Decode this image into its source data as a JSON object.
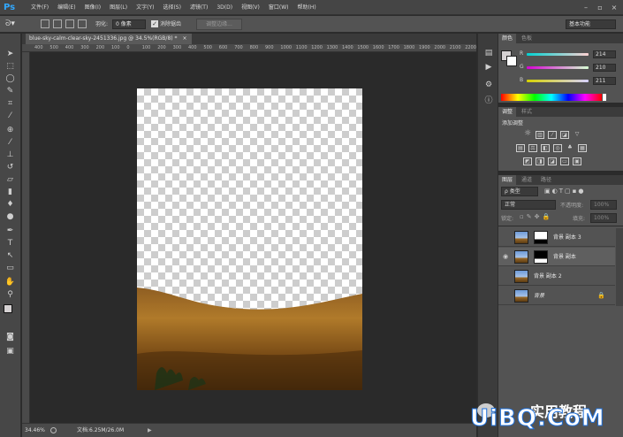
{
  "app": {
    "logo": "Ps"
  },
  "menu": [
    "文件(F)",
    "编辑(E)",
    "图像(I)",
    "图层(L)",
    "文字(Y)",
    "选择(S)",
    "滤镜(T)",
    "3D(D)",
    "视图(V)",
    "窗口(W)",
    "帮助(H)"
  ],
  "window_controls": {
    "minimize": "–",
    "restore": "▫",
    "close": "×"
  },
  "options": {
    "feather_label": "羽化:",
    "feather_value": "0 像素",
    "antialias_label": "消除锯齿",
    "antialias_checked": true,
    "refine_edge": "调整边缘...",
    "workspace": "基本功能"
  },
  "document": {
    "tab_title": "blue-sky-calm-clear-sky-2451336.jpg @ 34.5%(RGB/8) *",
    "close": "×"
  },
  "ruler": {
    "top_ticks": [
      "400",
      "500",
      "400",
      "300",
      "200",
      "100",
      "0",
      "100",
      "200",
      "300",
      "400",
      "500",
      "600",
      "700",
      "800",
      "900",
      "1000",
      "1100",
      "1200",
      "1300",
      "1400",
      "1500",
      "1600",
      "1700",
      "1800",
      "1900",
      "2000",
      "2100",
      "2200"
    ]
  },
  "status": {
    "zoom": "34.46%",
    "doc_info": "文档:6.25M/26.0M"
  },
  "color_panel": {
    "tabs": [
      "颜色",
      "色板"
    ],
    "r_label": "R",
    "r_value": "214",
    "g_label": "G",
    "g_value": "210",
    "b_label": "B",
    "b_value": "211"
  },
  "adjust_panel": {
    "tabs": [
      "调整",
      "样式"
    ],
    "title": "添加调整"
  },
  "layers_panel": {
    "tabs": [
      "图层",
      "通道",
      "路径"
    ],
    "kind_filter": "ρ 类型",
    "blend_mode": "正常",
    "opacity_label": "不透明度:",
    "opacity_value": "100%",
    "lock_label": "锁定:",
    "fill_label": "填充:",
    "fill_value": "100%",
    "layers": [
      {
        "name": "背景 副本 3",
        "visible": false,
        "mask": "white-top"
      },
      {
        "name": "背景 副本",
        "visible": true,
        "mask": "white-top"
      },
      {
        "name": "背景 副本 2",
        "visible": false,
        "mask": ""
      },
      {
        "name": "背景",
        "visible": false,
        "mask": "",
        "locked": true
      }
    ]
  },
  "watermark": {
    "text1": "实用教程",
    "text2": "UiBQ.CoM"
  },
  "colors": {
    "accent": "#31a8ff",
    "ground_light": "#b07a2a",
    "ground_dark": "#3c2408"
  }
}
